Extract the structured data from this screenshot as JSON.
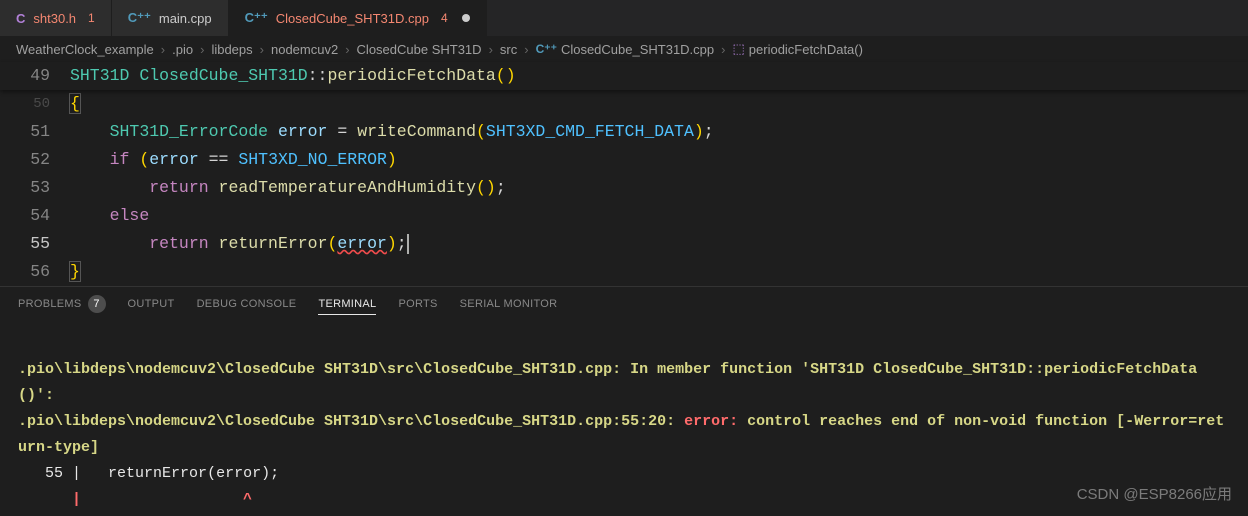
{
  "tabs": [
    {
      "icon": "C",
      "iconClass": "icon-c",
      "label": "sht30.h",
      "badge": "1",
      "badgeColor": "#f88",
      "active": false,
      "dirty": false
    },
    {
      "icon": "C⁺⁺",
      "iconClass": "icon-cpp",
      "label": "main.cpp",
      "badge": "",
      "active": false,
      "dirty": false
    },
    {
      "icon": "C⁺⁺",
      "iconClass": "icon-cpp",
      "label": "ClosedCube_SHT31D.cpp",
      "labelColor": "#f48771",
      "badge": "4",
      "badgeColor": "#f88",
      "active": true,
      "dirty": true
    }
  ],
  "breadcrumbs": {
    "items": [
      "WeatherClock_example",
      ".pio",
      "libdeps",
      "nodemcuv2",
      "ClosedCube SHT31D",
      "src"
    ],
    "file": "ClosedCube_SHT31D.cpp",
    "symbol": "periodicFetchData()"
  },
  "code": {
    "sticky": {
      "no": "49",
      "type": "SHT31D",
      "cls": "ClosedCube_SHT31D",
      "fn": "periodicFetchData"
    },
    "lines": [
      {
        "no": "50",
        "dim": true,
        "brace": "{"
      },
      {
        "no": "51",
        "type": "SHT31D_ErrorCode",
        "var": "error",
        "op": "=",
        "fn": "writeCommand",
        "arg": "SHT3XD_CMD_FETCH_DATA"
      },
      {
        "no": "52",
        "kw": "if",
        "lp": "(",
        "var": "error",
        "cmp": "==",
        "const": "SHT3XD_NO_ERROR",
        "rp": ")"
      },
      {
        "no": "53",
        "kw": "return",
        "fn": "readTemperatureAndHumidity"
      },
      {
        "no": "54",
        "kw": "else"
      },
      {
        "no": "55",
        "kw": "return",
        "fn": "returnError",
        "arg": "error",
        "errArg": true
      },
      {
        "no": "56",
        "brace": "}"
      }
    ]
  },
  "panel": {
    "tabs": [
      {
        "label": "PROBLEMS",
        "badge": "7"
      },
      {
        "label": "OUTPUT"
      },
      {
        "label": "DEBUG CONSOLE"
      },
      {
        "label": "TERMINAL",
        "active": true
      },
      {
        "label": "PORTS"
      },
      {
        "label": "SERIAL MONITOR"
      }
    ]
  },
  "terminal": {
    "line1_path": ".pio\\libdeps\\nodemcuv2\\ClosedCube SHT31D\\src\\ClosedCube_SHT31D.cpp:",
    "line1_msg": " In member function 'SHT31D ClosedCube_SHT31D::periodicFetchData()':",
    "line2_path": ".pio\\libdeps\\nodemcuv2\\ClosedCube SHT31D\\src\\ClosedCube_SHT31D.cpp:55:20: ",
    "line2_err": "error: ",
    "line2_msg": "control reaches end of non-void function [-Werror=return-type]",
    "line3_no": "   55",
    "line3_sep": " |   ",
    "line3_code": "returnError(error);",
    "line4": "      |                  ^"
  },
  "watermark": "CSDN @ESP8266应用"
}
